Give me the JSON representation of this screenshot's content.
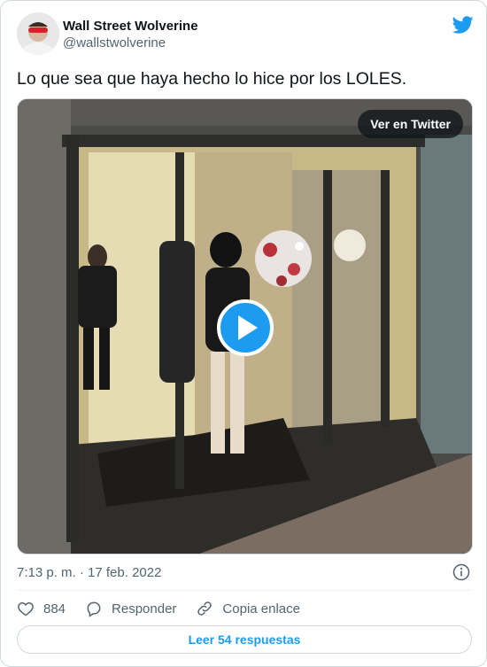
{
  "author": {
    "display_name": "Wall Street Wolverine",
    "handle": "@wallstwolverine",
    "avatar_icon": "avatar-photo"
  },
  "tweet": {
    "text": "Lo que sea que haya hecho lo hice por los LOLES."
  },
  "media": {
    "type": "video",
    "watch_label": "Ver en Twitter",
    "play_icon": "play-icon"
  },
  "meta": {
    "timestamp": "7:13 p. m. · 17 feb. 2022"
  },
  "actions": {
    "like_count": "884",
    "reply_label": "Responder",
    "copy_label": "Copia enlace"
  },
  "footer": {
    "replies_label": "Leer 54 respuestas"
  },
  "colors": {
    "brand": "#1d9bf0",
    "text_primary": "#0f1419",
    "text_secondary": "#536471",
    "border": "#cfd9de"
  }
}
